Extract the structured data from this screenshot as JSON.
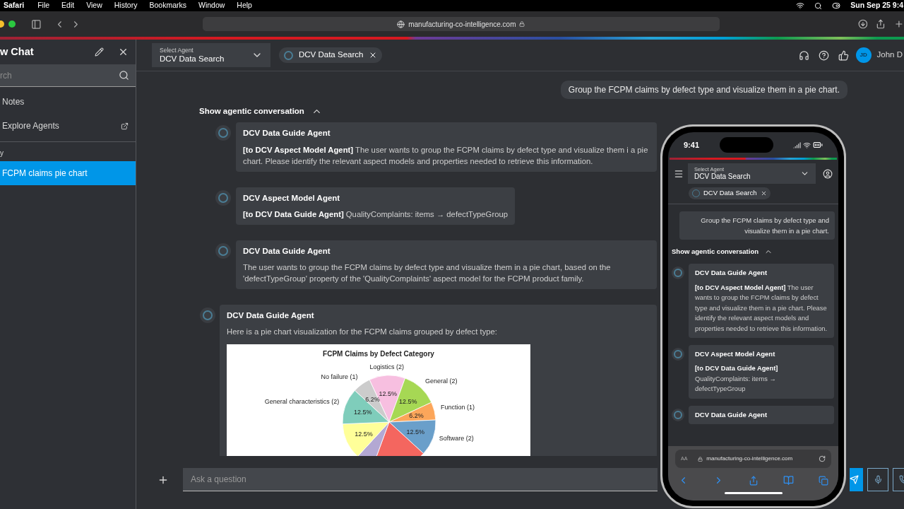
{
  "menu_bar": {
    "app": "Safari",
    "items": [
      "File",
      "Edit",
      "View",
      "History",
      "Bookmarks",
      "Window",
      "Help"
    ],
    "clock": "Sun Sep 25 9:4"
  },
  "browser": {
    "url": "manufacturing-co-intelligence.com"
  },
  "sidebar": {
    "title": "w Chat",
    "search": {
      "placeholder": "rch"
    },
    "items": [
      {
        "label": "Notes",
        "kind": "link"
      },
      {
        "label": "Explore Agents",
        "kind": "external"
      }
    ],
    "section": "y",
    "chats": [
      {
        "label": "FCPM claims pie chart",
        "selected": true
      }
    ]
  },
  "header": {
    "agent_select": {
      "label": "Select Agent",
      "value": "DCV Data Search"
    },
    "chips": [
      "DCV Data Search"
    ],
    "user": {
      "initials": "JD",
      "name": "John D"
    }
  },
  "chat": {
    "user_message": "Group the FCPM claims by defect type and visualize them in a pie chart.",
    "toggle": {
      "label": "Show agentic conversation",
      "expanded": true
    },
    "messages": [
      {
        "kind": "step",
        "agent": "DCV Data Guide Agent",
        "body": "**[to DCV Aspect Model Agent]** The user wants to group the FCPM claims by defect type and visualize them i a pie chart. Please identify the relevant aspect models and properties needed to retrieve this information."
      },
      {
        "kind": "step",
        "agent": "DCV Aspect Model Agent",
        "body": "**[to DCV Data Guide Agent]** QualityComplaints: items → defectTypeGroup"
      },
      {
        "kind": "step",
        "agent": "DCV Data Guide Agent",
        "body": "The user wants to group the FCPM claims by defect type and visualize them in a pie chart, based on the 'defectTypeGroup' property of the 'QualityComplaints' aspect model for the FCPM product family."
      },
      {
        "kind": "answer",
        "agent": "DCV Data Guide Agent",
        "body": "Here is a pie chart visualization for the FCPM claims grouped by defect type:",
        "chart_data": {
          "type": "pie",
          "title": "FCPM Claims by Defect Category",
          "categories": [
            "Logistics (2)",
            "General (2)",
            "Function (1)",
            "Software (2)",
            null,
            null,
            null,
            "General characteristics (2)",
            "No failure (1)"
          ],
          "values": [
            12.5,
            12.5,
            6.2,
            12.5,
            18.8,
            6.2,
            12.5,
            12.5,
            6.2
          ],
          "colors": [
            "#f7bfe0",
            "#a6d854",
            "#fca65a",
            "#6a9fca",
            "#f4665f",
            "#b3a8d3",
            "#ffff99",
            "#7fcdbb",
            "#cccccc"
          ],
          "value_labels": [
            "12.5%",
            "12.5%",
            "6.2%",
            "12.5%",
            null,
            null,
            "12.5%",
            "12.5%",
            "6.2%"
          ]
        }
      }
    ]
  },
  "composer": {
    "placeholder": "Ask a question"
  },
  "phone": {
    "time": "9:41",
    "agent_select": {
      "label": "Select Agent",
      "value": "DCV Data Search"
    },
    "chips": [
      "DCV Data Search"
    ],
    "user_message": "Group the FCPM claims by defect type and visualize them in a pie chart.",
    "toggle": {
      "label": "Show agentic conversation",
      "expanded": true
    },
    "messages": [
      {
        "agent": "DCV Data Guide Agent",
        "body": "**[to DCV Aspect Model Agent]** The user wants to group the FCPM claims by defect type and visualize them in a pie chart. Please identify the relevant aspect models and properties needed to retrieve this information."
      },
      {
        "agent": "DCV Aspect Model Agent",
        "body": "**[to DCV Data Guide Agent]** QualityComplaints: items → defectTypeGroup"
      },
      {
        "agent": "DCV Data Guide Agent"
      }
    ],
    "text_size": "AA",
    "url": "manufacturing-co-intelligence.com"
  }
}
